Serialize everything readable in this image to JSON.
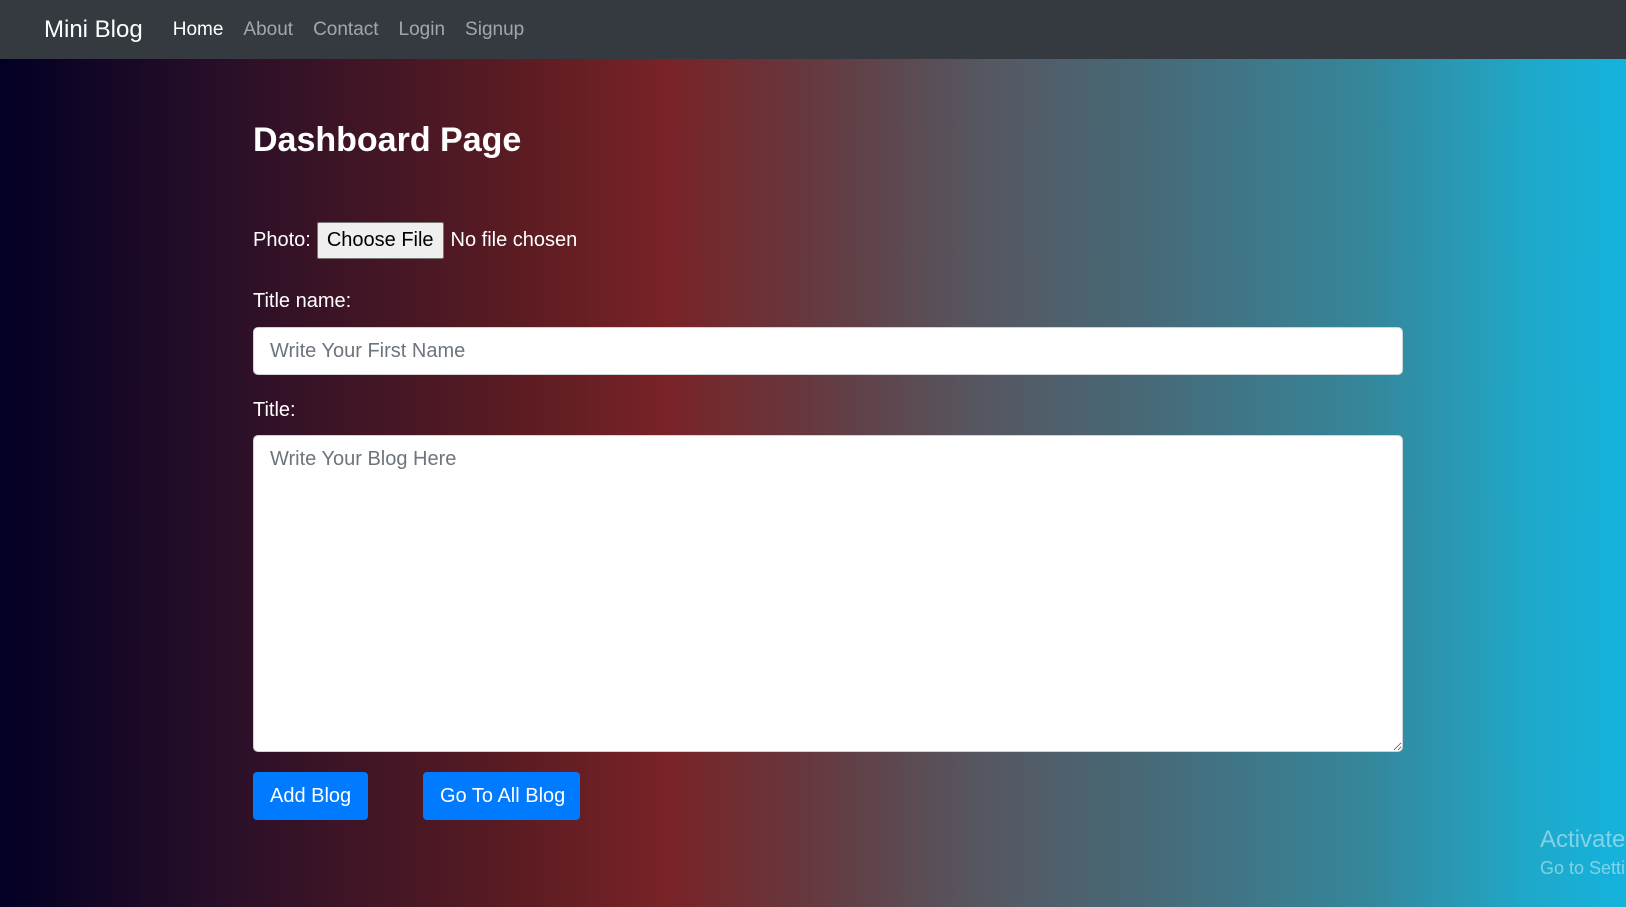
{
  "navbar": {
    "brand": "Mini Blog",
    "links": [
      {
        "label": "Home",
        "active": true
      },
      {
        "label": "About",
        "active": false
      },
      {
        "label": "Contact",
        "active": false
      },
      {
        "label": "Login",
        "active": false
      },
      {
        "label": "Signup",
        "active": false
      }
    ]
  },
  "main": {
    "title": "Dashboard Page",
    "photo": {
      "label": "Photo:",
      "button_label": "Choose File",
      "status": "No file chosen"
    },
    "title_name": {
      "label": "Title name:",
      "placeholder": "Write Your First Name",
      "value": ""
    },
    "blog": {
      "label": "Title:",
      "placeholder": "Write Your Blog Here",
      "value": ""
    },
    "buttons": {
      "add_label": "Add Blog",
      "all_label": "Go To All Blog"
    }
  },
  "watermark": {
    "line1": "Activate Windows",
    "line2": "Go to Settings to activate Windows."
  },
  "colors": {
    "navbar_bg": "#343a40",
    "primary_button": "#007bff",
    "gradient_start": "#020024",
    "gradient_mid": "#792327",
    "gradient_end": "#14b3dd"
  }
}
